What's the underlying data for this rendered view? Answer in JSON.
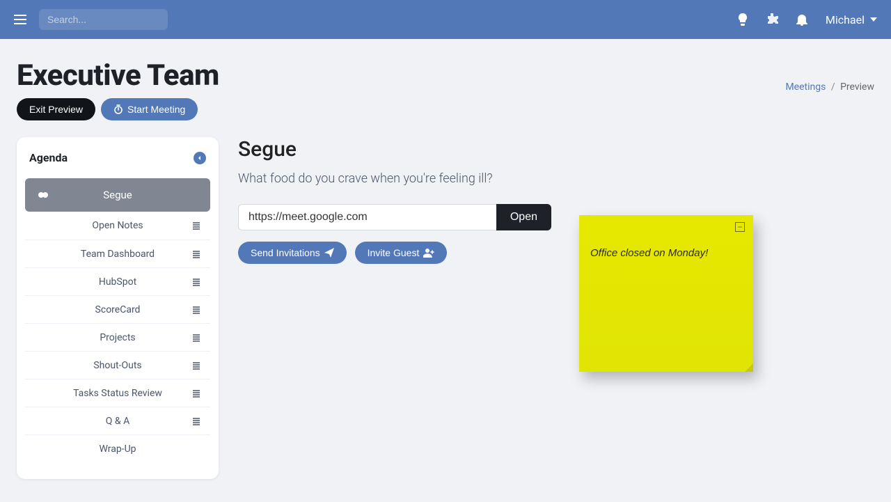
{
  "topnav": {
    "search_placeholder": "Search...",
    "user_name": "Michael"
  },
  "page": {
    "title": "Executive Team",
    "exit_preview": "Exit Preview",
    "start_meeting": "Start Meeting"
  },
  "breadcrumb": {
    "meetings": "Meetings",
    "sep": "/",
    "current": "Preview"
  },
  "agenda": {
    "title": "Agenda",
    "items": [
      {
        "label": "Segue",
        "active": true
      },
      {
        "label": "Open Notes"
      },
      {
        "label": "Team Dashboard"
      },
      {
        "label": "HubSpot"
      },
      {
        "label": "ScoreCard"
      },
      {
        "label": "Projects"
      },
      {
        "label": "Shout-Outs"
      },
      {
        "label": "Tasks Status Review"
      },
      {
        "label": "Q & A"
      },
      {
        "label": "Wrap-Up"
      }
    ]
  },
  "section": {
    "title": "Segue",
    "prompt": "What food do you crave when you're feeling ill?",
    "url": "https://meet.google.com",
    "open": "Open",
    "send_invitations": "Send Invitations",
    "invite_guest": "Invite Guest"
  },
  "sticky": {
    "text": "Office closed on Monday!"
  }
}
